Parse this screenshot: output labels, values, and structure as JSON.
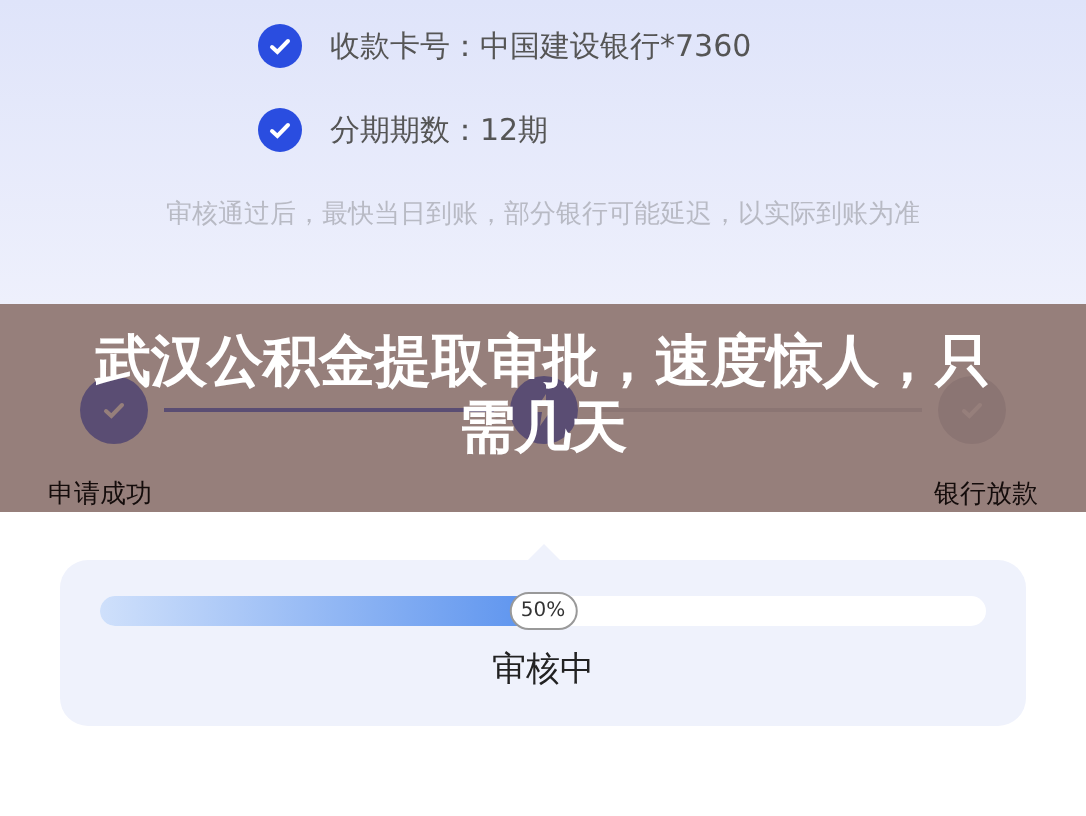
{
  "details": [
    {
      "label": "收款卡号：中国建设银行*7360",
      "checked": true
    },
    {
      "label": "分期期数：12期",
      "checked": true
    }
  ],
  "notice": "审核通过后，最快当日到账，部分银行可能延迟，以实际到账为准",
  "steps": [
    {
      "label": "申请成功",
      "kind": "check",
      "done": true
    },
    {
      "kind": "bolt",
      "done": true
    },
    {
      "label": "银行放款",
      "kind": "check",
      "done": false
    }
  ],
  "progress": {
    "level": 0.5,
    "reading": "50%",
    "status": "审核中"
  },
  "banner": {
    "title": "武汉公积金提取审批，速度惊人，只需几天"
  }
}
